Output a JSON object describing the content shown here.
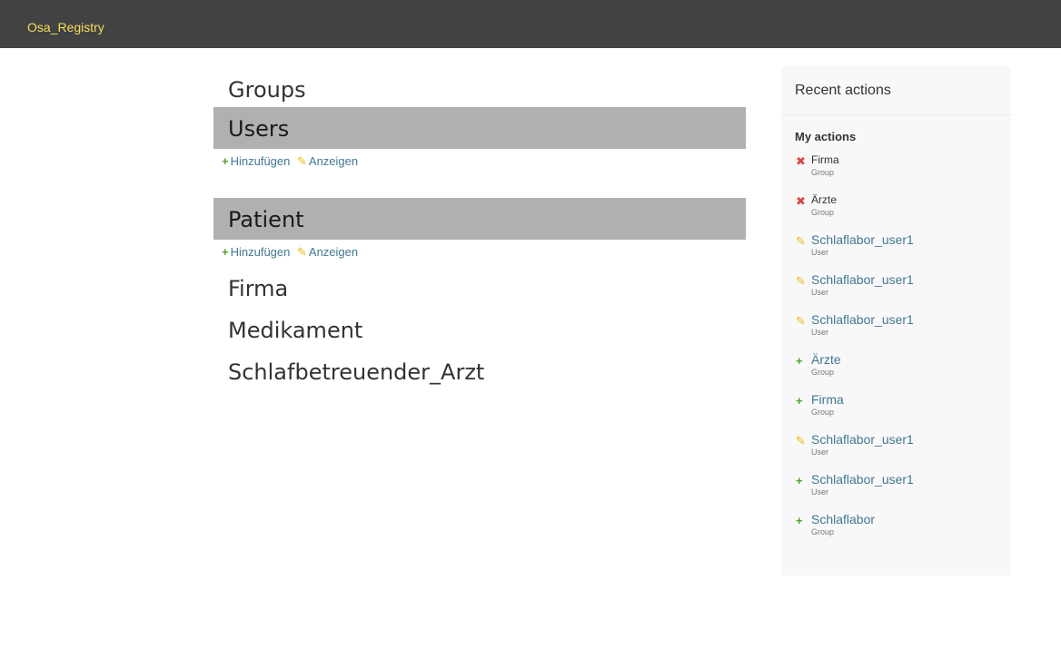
{
  "header": {
    "brand": "Osa_Registry"
  },
  "main": {
    "groups_heading": "Groups",
    "users": {
      "title": "Users",
      "add_label": "Hinzufügen",
      "view_label": "Anzeigen"
    },
    "patient": {
      "title": "Patient",
      "add_label": "Hinzufügen",
      "view_label": "Anzeigen"
    },
    "other_models": [
      "Firma",
      "Medikament",
      "Schlafbetreuender_Arzt"
    ]
  },
  "sidebar": {
    "title": "Recent actions",
    "subtitle": "My actions",
    "items": [
      {
        "action": "delete",
        "name": "Firma",
        "type": "Group"
      },
      {
        "action": "delete",
        "name": "Ärzte",
        "type": "Group"
      },
      {
        "action": "change",
        "name": "Schlaflabor_user1",
        "type": "User"
      },
      {
        "action": "change",
        "name": "Schlaflabor_user1",
        "type": "User"
      },
      {
        "action": "change",
        "name": "Schlaflabor_user1",
        "type": "User"
      },
      {
        "action": "add",
        "name": "Ärzte",
        "type": "Group"
      },
      {
        "action": "add",
        "name": "Firma",
        "type": "Group"
      },
      {
        "action": "change",
        "name": "Schlaflabor_user1",
        "type": "User"
      },
      {
        "action": "add",
        "name": "Schlaflabor_user1",
        "type": "User"
      },
      {
        "action": "add",
        "name": "Schlaflabor",
        "type": "Group"
      }
    ]
  },
  "colors": {
    "topbar": "#424242",
    "brand": "#f5dd5d",
    "model_bar": "#b0b0b0",
    "link": "#417893",
    "add_icon": "#5aa02c",
    "change_icon": "#efb80b",
    "delete_icon": "#dd4646"
  }
}
